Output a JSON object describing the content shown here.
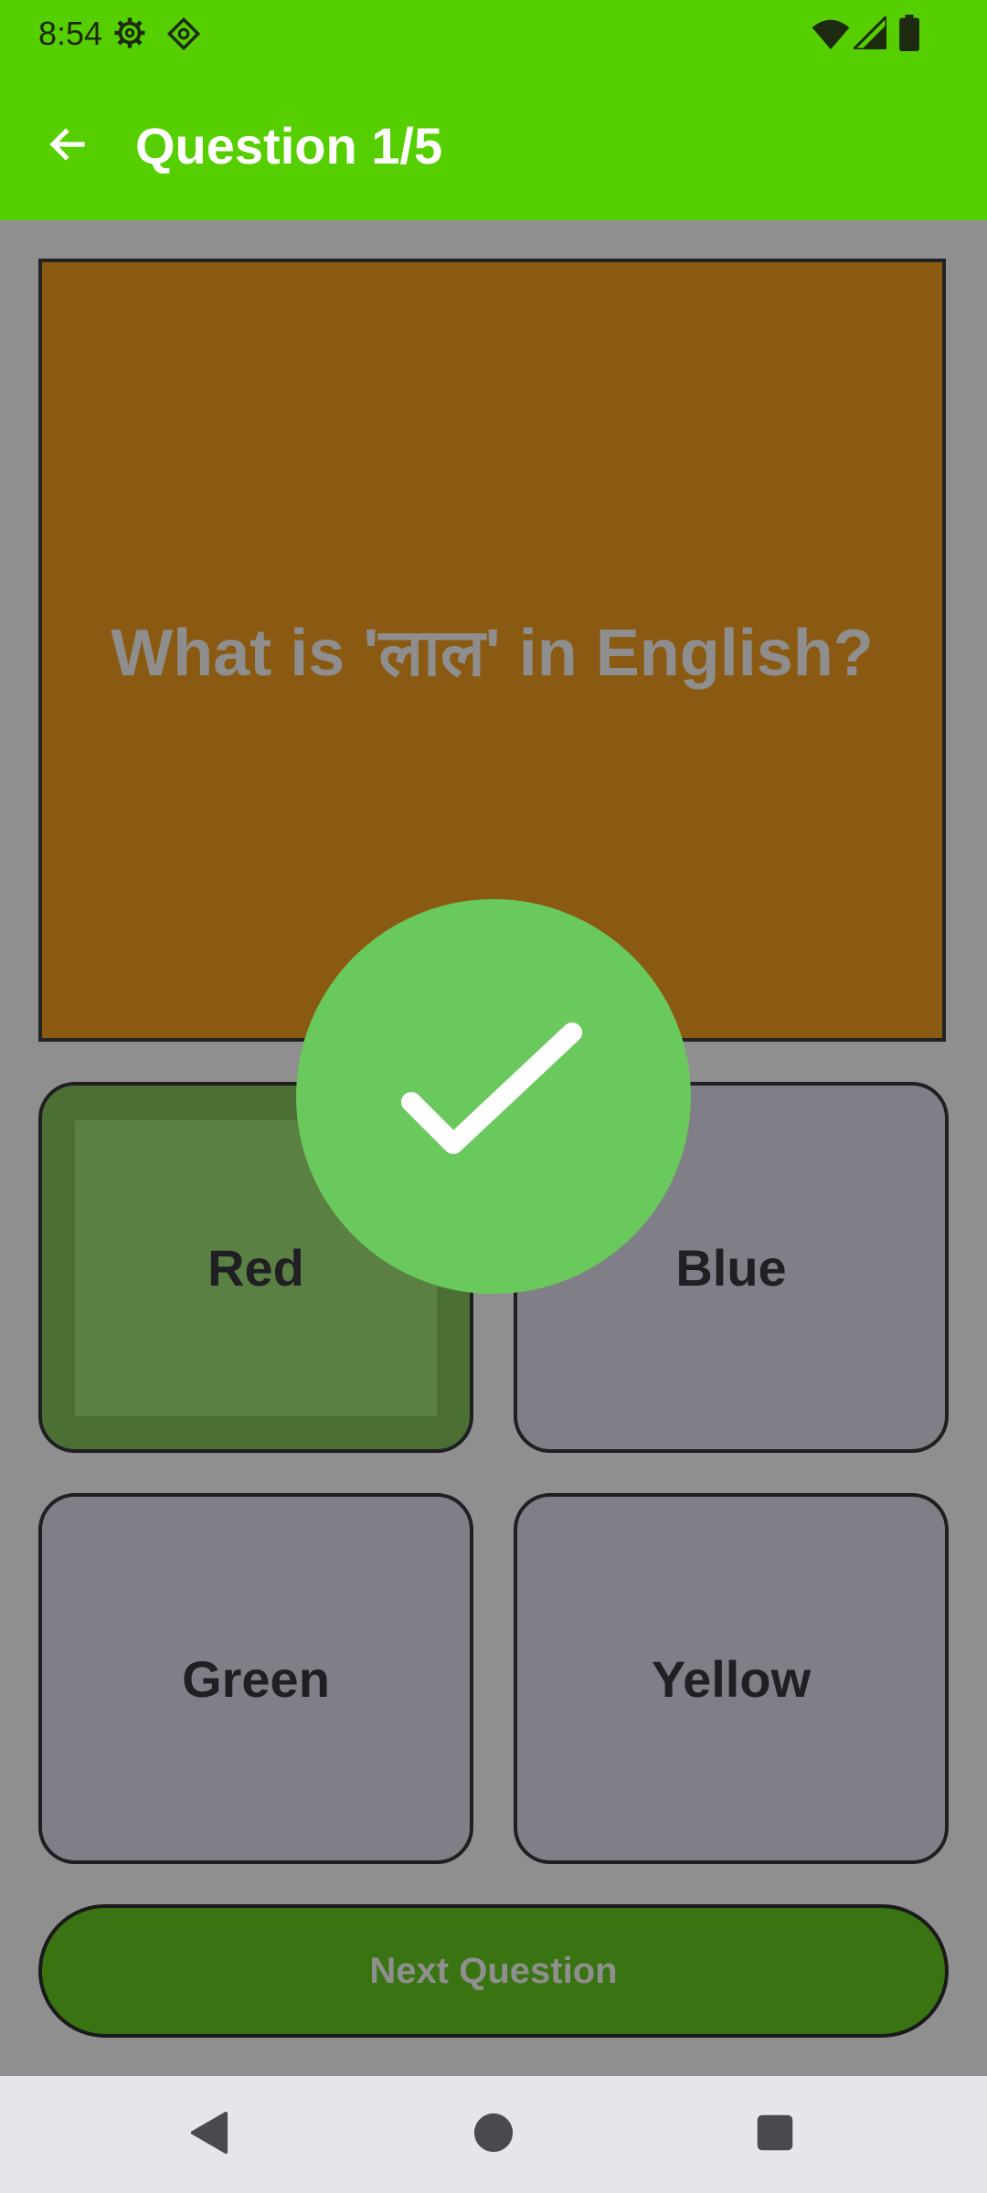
{
  "status_bar": {
    "time": "8:54",
    "icons": [
      "settings-icon",
      "diamond-icon",
      "wifi-icon",
      "signal-icon",
      "battery-icon"
    ]
  },
  "app_bar": {
    "title": "Question 1/5",
    "back_icon": "arrow-left-icon"
  },
  "question": {
    "text": "What is 'लाल' in English?"
  },
  "options": [
    {
      "label": "Red",
      "state": "correct"
    },
    {
      "label": "Blue",
      "state": "default"
    },
    {
      "label": "Green",
      "state": "default"
    },
    {
      "label": "Yellow",
      "state": "default"
    }
  ],
  "next_button": {
    "label": "Next Question"
  },
  "feedback": {
    "icon": "check-icon",
    "state": "correct"
  },
  "nav_bar": {
    "icons": [
      "back-triangle-icon",
      "home-circle-icon",
      "recents-square-icon"
    ]
  },
  "colors": {
    "app_bar": "#56cf00",
    "card": "#8b5a12",
    "overlay": "#8f8f90",
    "correct_option": "#4c6f36",
    "option": "#807e86",
    "next_button": "#3a7412",
    "check_badge": "#6ac95c"
  }
}
